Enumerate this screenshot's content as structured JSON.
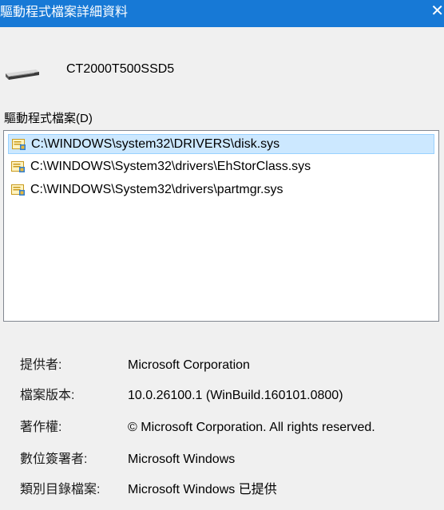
{
  "window": {
    "title": "驅動程式檔案詳細資料",
    "close_glyph": "✕"
  },
  "device": {
    "icon": "drive-icon",
    "name": "CT2000T500SSD5"
  },
  "driver_files": {
    "label": "驅動程式檔案(D)",
    "items": [
      {
        "path": "C:\\WINDOWS\\system32\\DRIVERS\\disk.sys",
        "selected": true,
        "icon": "signed-file-icon"
      },
      {
        "path": "C:\\WINDOWS\\System32\\drivers\\EhStorClass.sys",
        "selected": false,
        "icon": "signed-file-icon"
      },
      {
        "path": "C:\\WINDOWS\\System32\\drivers\\partmgr.sys",
        "selected": false,
        "icon": "signed-file-icon"
      }
    ]
  },
  "details": {
    "provider": {
      "label": "提供者:",
      "value": "Microsoft Corporation"
    },
    "file_version": {
      "label": "檔案版本:",
      "value": "10.0.26100.1 (WinBuild.160101.0800)"
    },
    "copyright": {
      "label": "著作權:",
      "value": "© Microsoft Corporation. All rights reserved."
    },
    "digital_signer": {
      "label": "數位簽署者:",
      "value": "Microsoft Windows"
    },
    "catalog_file": {
      "label": "類別目錄檔案:",
      "value": "Microsoft Windows 已提供"
    }
  },
  "colors": {
    "titlebar": "#1779d6",
    "selection": "#cce8ff",
    "selection_border": "#99d1ff"
  }
}
